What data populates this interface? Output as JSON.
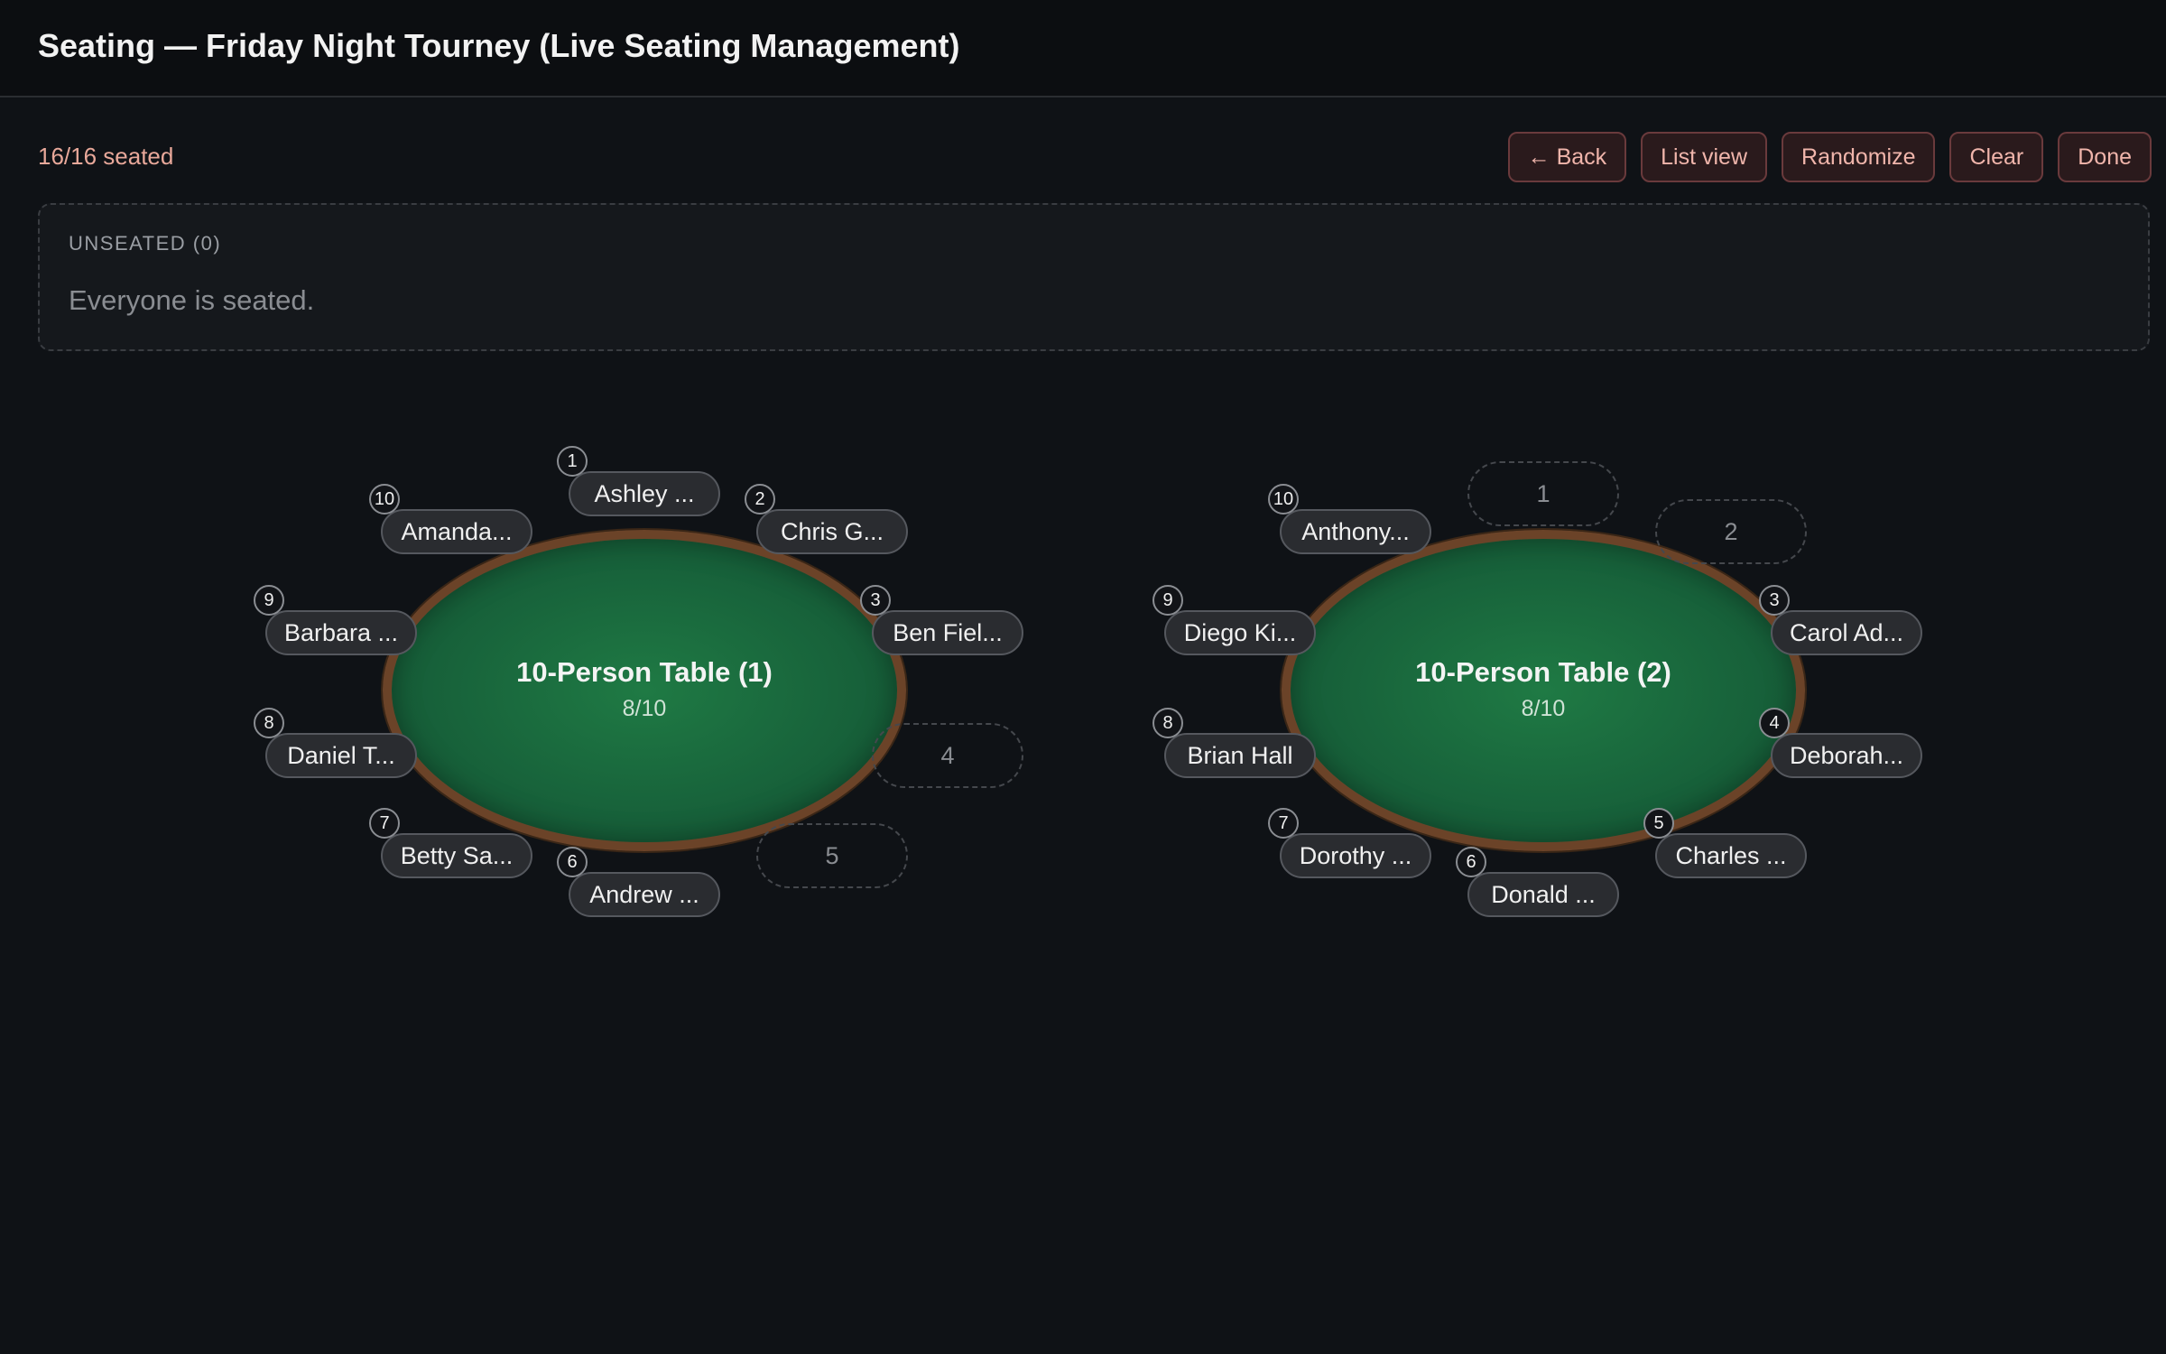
{
  "header": {
    "title": "Seating — Friday Night Tourney (Live Seating Management)"
  },
  "summary": {
    "seated_count": "16/16 seated"
  },
  "actions": {
    "back": "← Back",
    "list_view": "List view",
    "randomize": "Randomize",
    "clear": "Clear",
    "done": "Done"
  },
  "unseated": {
    "heading": "UNSEATED (0)",
    "empty_message": "Everyone is seated."
  },
  "tables": [
    {
      "name": "10-Person Table (1)",
      "capacity": "8/10",
      "seats": [
        {
          "number": "1",
          "player": "Ashley ..."
        },
        {
          "number": "2",
          "player": "Chris G..."
        },
        {
          "number": "3",
          "player": "Ben Fiel..."
        },
        {
          "number": "4",
          "player": ""
        },
        {
          "number": "5",
          "player": ""
        },
        {
          "number": "6",
          "player": "Andrew ..."
        },
        {
          "number": "7",
          "player": "Betty Sa..."
        },
        {
          "number": "8",
          "player": "Daniel T..."
        },
        {
          "number": "9",
          "player": "Barbara ..."
        },
        {
          "number": "10",
          "player": "Amanda..."
        }
      ]
    },
    {
      "name": "10-Person Table (2)",
      "capacity": "8/10",
      "seats": [
        {
          "number": "1",
          "player": ""
        },
        {
          "number": "2",
          "player": ""
        },
        {
          "number": "3",
          "player": "Carol Ad..."
        },
        {
          "number": "4",
          "player": "Deborah..."
        },
        {
          "number": "5",
          "player": "Charles ..."
        },
        {
          "number": "6",
          "player": "Donald ..."
        },
        {
          "number": "7",
          "player": "Dorothy ..."
        },
        {
          "number": "8",
          "player": "Brian Hall"
        },
        {
          "number": "9",
          "player": "Diego Ki..."
        },
        {
          "number": "10",
          "player": "Anthony..."
        }
      ]
    }
  ]
}
